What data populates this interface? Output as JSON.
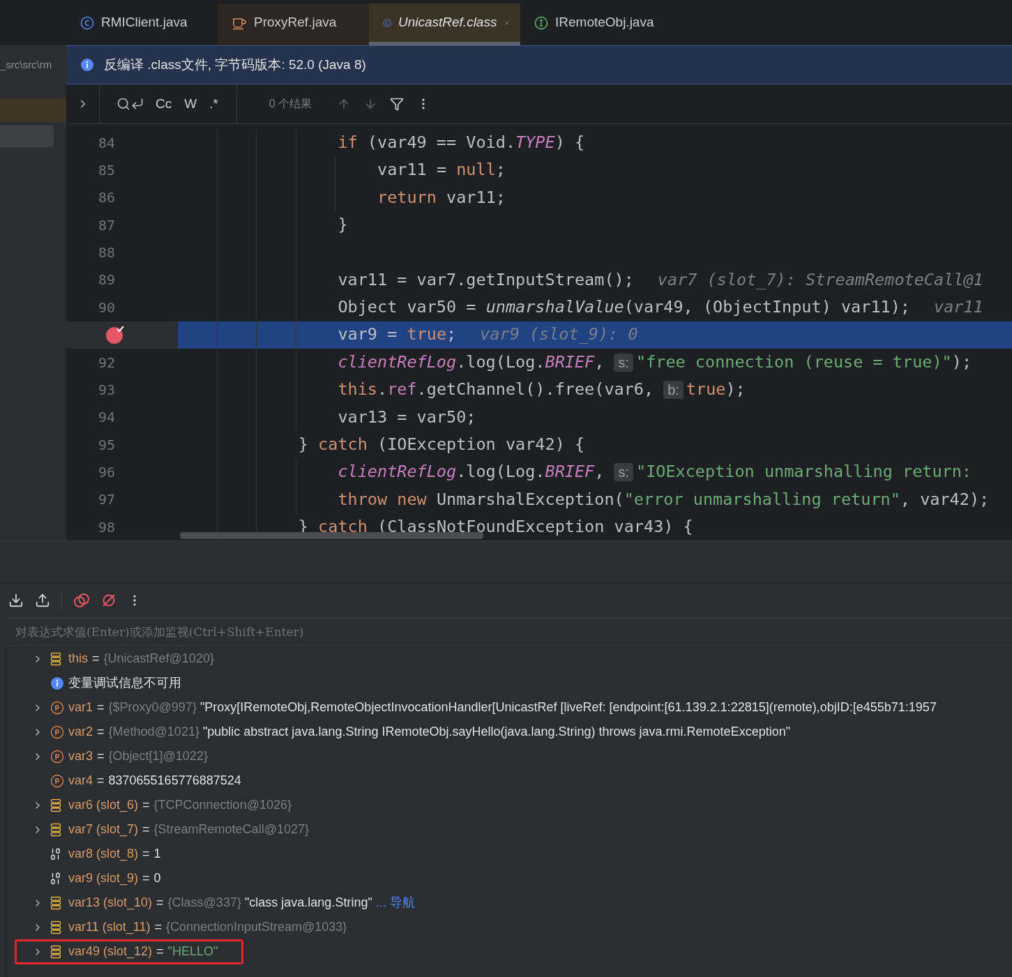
{
  "project_panel": {
    "path": "_src\\src\\rm"
  },
  "tabs": [
    {
      "label": "RMIClient.java",
      "kind": "class",
      "selected": false,
      "read_only": false
    },
    {
      "label": "ProxyRef.java",
      "kind": "java",
      "selected": false,
      "read_only": false
    },
    {
      "label": "UnicastRef.class",
      "kind": "class",
      "selected": true,
      "read_only": true
    },
    {
      "label": "IRemoteObj.java",
      "kind": "interface",
      "selected": false,
      "read_only": false
    }
  ],
  "banner": {
    "text": "反编译 .class文件, 字节码版本: 52.0 (Java 8)"
  },
  "find_bar": {
    "options": [
      "Cc",
      "W",
      ".*"
    ],
    "results": "0 个结果"
  },
  "code_lines": [
    {
      "children": [
        {
          "number": "84",
          "breakpoint": false,
          "selected": false,
          "tokens": [
            {
              "kind": "kw",
              "text": "if"
            },
            {
              "kind": "plain",
              "text": " (var49 == Void."
            },
            {
              "kind": "field",
              "text": "TYPE"
            },
            {
              "kind": "plain",
              "text": ") {"
            }
          ],
          "children": [
            {
              "number": "85",
              "breakpoint": false,
              "selected": false,
              "tokens": [
                {
                  "kind": "plain",
                  "text": "var11 = "
                },
                {
                  "kind": "kw",
                  "text": "null"
                },
                {
                  "kind": "plain",
                  "text": ";"
                }
              ]
            },
            {
              "number": "86",
              "breakpoint": false,
              "selected": false,
              "tokens": [
                {
                  "kind": "kw",
                  "text": "return"
                },
                {
                  "kind": "plain",
                  "text": " var11;"
                }
              ]
            }
          ]
        },
        {
          "number": "87",
          "breakpoint": false,
          "selected": false,
          "tokens": [
            {
              "kind": "plain",
              "text": "}"
            }
          ]
        },
        {
          "number": "88",
          "breakpoint": false,
          "selected": false
        },
        {
          "number": "89",
          "breakpoint": false,
          "selected": false,
          "tokens": [
            {
              "kind": "plain",
              "text": "var11 = var7.getInputStream();"
            },
            {
              "kind": "hint",
              "text": "var7 (slot_7): StreamRemoteCall@1"
            }
          ]
        },
        {
          "number": "90",
          "breakpoint": false,
          "selected": false,
          "tokens": [
            {
              "kind": "plain",
              "text": "Object var50 = "
            },
            {
              "kind": "call",
              "text": "unmarshalValue"
            },
            {
              "kind": "plain",
              "text": "(var49, (ObjectInput) var11);"
            },
            {
              "kind": "hint",
              "text": "var11"
            }
          ]
        },
        {
          "breakpoint": true,
          "selected": true,
          "tokens": [
            {
              "kind": "plain",
              "text": "var9 = "
            },
            {
              "kind": "kw",
              "text": "true"
            },
            {
              "kind": "plain",
              "text": ";"
            },
            {
              "kind": "hint",
              "text": "var9 (slot_9): 0"
            }
          ]
        },
        {
          "number": "92",
          "breakpoint": false,
          "selected": false,
          "tokens": [
            {
              "kind": "field",
              "text": "clientRefLog"
            },
            {
              "kind": "plain",
              "text": ".log(Log."
            },
            {
              "kind": "field",
              "text": "BRIEF"
            },
            {
              "kind": "plain",
              "text": ","
            },
            {
              "kind": "inlay",
              "text": "s:"
            },
            {
              "kind": "str",
              "text": "\"free connection (reuse = true)\""
            },
            {
              "kind": "plain",
              "text": ");"
            }
          ]
        },
        {
          "number": "93",
          "breakpoint": false,
          "selected": false,
          "tokens": [
            {
              "kind": "kw",
              "text": "this"
            },
            {
              "kind": "plain",
              "text": "."
            },
            {
              "kind": "member",
              "text": "ref"
            },
            {
              "kind": "plain",
              "text": ".getChannel().free(var6,"
            },
            {
              "kind": "inlay",
              "text": "b:"
            },
            {
              "kind": "kw",
              "text": "true"
            },
            {
              "kind": "plain",
              "text": ");"
            }
          ]
        },
        {
          "number": "94",
          "breakpoint": false,
          "selected": false,
          "tokens": [
            {
              "kind": "plain",
              "text": "var13 = var50;"
            }
          ]
        }
      ]
    },
    {
      "number": "95",
      "breakpoint": false,
      "selected": false,
      "tokens": [
        {
          "kind": "plain",
          "text": "} "
        },
        {
          "kind": "kw",
          "text": "catch"
        },
        {
          "kind": "plain",
          "text": " (IOException var42) {"
        }
      ],
      "children": [
        {
          "number": "96",
          "breakpoint": false,
          "selected": false,
          "tokens": [
            {
              "kind": "field",
              "text": "clientRefLog"
            },
            {
              "kind": "plain",
              "text": ".log(Log."
            },
            {
              "kind": "field",
              "text": "BRIEF"
            },
            {
              "kind": "plain",
              "text": ","
            },
            {
              "kind": "inlay",
              "text": "s:"
            },
            {
              "kind": "str",
              "text": "\"IOException unmarshalling return:"
            }
          ]
        },
        {
          "number": "97",
          "breakpoint": false,
          "selected": false,
          "tokens": [
            {
              "kind": "kw",
              "text": "throw new"
            },
            {
              "kind": "plain",
              "text": " UnmarshalException("
            },
            {
              "kind": "str",
              "text": "\"error unmarshalling return\""
            },
            {
              "kind": "plain",
              "text": ", var42);"
            }
          ]
        }
      ]
    },
    {
      "number": "98",
      "breakpoint": false,
      "selected": false,
      "tokens": [
        {
          "kind": "plain",
          "text": "} "
        },
        {
          "kind": "kw",
          "text": "catch"
        },
        {
          "kind": "plain",
          "text": " (ClassNotFoundException var43) {"
        }
      ]
    }
  ],
  "debugger": {
    "eval_placeholder": "对表达式求值(Enter)或添加监视(Ctrl+Shift+Enter)",
    "variables": [
      {
        "kind": "object",
        "expandable": true,
        "name": "this",
        "operator": "=",
        "type": "{UnicastRef@1020}",
        "marked": false
      },
      {
        "kind": "info",
        "expandable": false,
        "name": "变量调试信息不可用",
        "marked": false
      },
      {
        "kind": "param",
        "expandable": true,
        "name": "var1",
        "operator": "=",
        "type": "{$Proxy0@997}",
        "value": "\"Proxy[IRemoteObj,RemoteObjectInvocationHandler[UnicastRef [liveRef: [endpoint:[61.139.2.1:22815](remote),objID:[e455b71:1957",
        "string_literal": false,
        "marked": false
      },
      {
        "kind": "param",
        "expandable": true,
        "name": "var2",
        "operator": "=",
        "type": "{Method@1021}",
        "value": "\"public abstract java.lang.String IRemoteObj.sayHello(java.lang.String) throws java.rmi.RemoteException\"",
        "string_literal": false,
        "marked": false
      },
      {
        "kind": "param",
        "expandable": true,
        "name": "var3",
        "operator": "=",
        "type": "{Object[1]@1022}",
        "marked": false
      },
      {
        "kind": "param",
        "expandable": false,
        "name": "var4",
        "operator": "=",
        "value": "8370655165776887524",
        "string_literal": false,
        "marked": false
      },
      {
        "kind": "object",
        "expandable": true,
        "name": "var6 (slot_6)",
        "operator": "=",
        "type": "{TCPConnection@1026}",
        "marked": false
      },
      {
        "kind": "object",
        "expandable": true,
        "name": "var7 (slot_7)",
        "operator": "=",
        "type": "{StreamRemoteCall@1027}",
        "marked": false
      },
      {
        "kind": "primitive",
        "expandable": false,
        "name": "var8 (slot_8)",
        "operator": "=",
        "value": "1",
        "string_literal": false,
        "marked": false
      },
      {
        "kind": "primitive",
        "expandable": false,
        "name": "var9 (slot_9)",
        "operator": "=",
        "value": "0",
        "string_literal": false,
        "marked": false
      },
      {
        "kind": "object",
        "expandable": true,
        "name": "var13 (slot_10)",
        "operator": "=",
        "type": "{Class@337}",
        "value": "\"class java.lang.String\"",
        "string_literal": false,
        "link": "... 导航",
        "marked": false
      },
      {
        "kind": "object",
        "expandable": true,
        "name": "var11 (slot_11)",
        "operator": "=",
        "type": "{ConnectionInputStream@1033}",
        "marked": false
      },
      {
        "kind": "object",
        "expandable": true,
        "name": "var49 (slot_12)",
        "operator": "=",
        "value": "\"HELLO\"",
        "string_literal": true,
        "marked": true
      }
    ]
  }
}
